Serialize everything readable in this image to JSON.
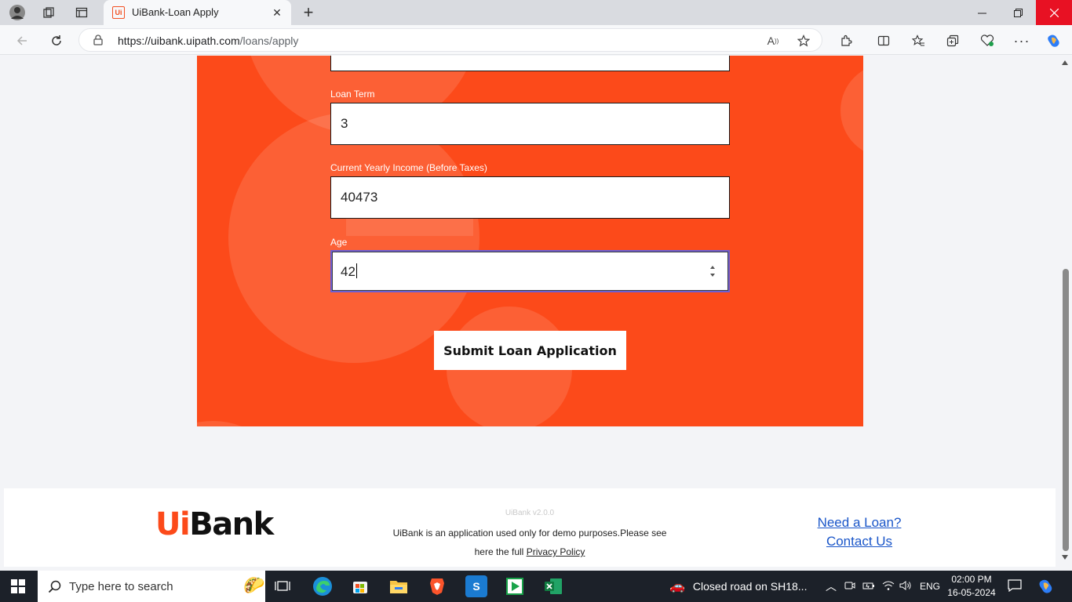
{
  "browser": {
    "tab_title": "UiBank-Loan Apply",
    "favicon_text": "Ui",
    "url_host": "https://uibank.uipath.com",
    "url_path": "/loans/apply"
  },
  "form": {
    "loan_term": {
      "label": "Loan Term",
      "value": "3"
    },
    "yearly_income": {
      "label": "Current Yearly Income (Before Taxes)",
      "value": "40473"
    },
    "age": {
      "label": "Age",
      "value": "42"
    },
    "submit_label": "Submit Loan Application"
  },
  "footer": {
    "logo_ui": "Ui",
    "logo_bank": "Bank",
    "version": "UiBank v2.0.0",
    "disclaimer": "UiBank is an application used only for demo purposes.Please see",
    "disclaimer_line2": "here the full",
    "privacy_link": "Privacy Policy",
    "need_loan_link": "Need a Loan?",
    "contact_link": "Contact Us"
  },
  "taskbar": {
    "search_placeholder": "Type here to search",
    "notification": "Closed road on SH18...",
    "language": "ENG",
    "time": "02:00 PM",
    "date": "16-05-2024"
  },
  "colors": {
    "brand_orange": "#fc4a1a",
    "link_blue": "#1a56c9",
    "focus_border": "#6b5fd3"
  }
}
